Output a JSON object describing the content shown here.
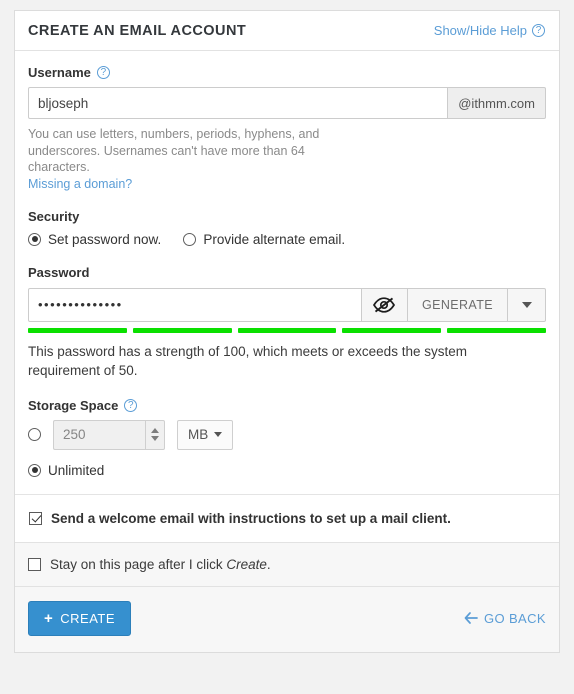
{
  "header": {
    "title": "CREATE AN EMAIL ACCOUNT",
    "help_toggle": "Show/Hide Help",
    "help_icon": "question-circle-icon"
  },
  "username": {
    "label": "Username",
    "help_icon": "question-circle-icon",
    "value": "bljoseph",
    "placeholder": "",
    "domain_addon": "@ithmm.com",
    "help_text": "You can use letters, numbers, periods, hyphens, and underscores. Usernames can't have more than 64 characters.",
    "missing_domain_link": "Missing a domain?"
  },
  "security": {
    "section_label": "Security",
    "options": [
      {
        "label": "Set password now.",
        "selected": true
      },
      {
        "label": "Provide alternate email.",
        "selected": false
      }
    ]
  },
  "password": {
    "label": "Password",
    "value": "••••••••••••••",
    "toggle_icon": "eye-slash-icon",
    "generate_label": "GENERATE",
    "caret_icon": "chevron-down-icon",
    "strength_segments": 5,
    "strength_color": "#0ae000",
    "strength_text": "This password has a strength of 100, which meets or exceeds the system requirement of 50.",
    "strength_value": 100,
    "strength_requirement": 50
  },
  "storage": {
    "label": "Storage Space",
    "help_icon": "question-circle-icon",
    "quota_selected": false,
    "quota_value": "250",
    "unit": "MB",
    "unit_caret_icon": "chevron-down-icon",
    "spinner_up_icon": "spinner-up-icon",
    "spinner_down_icon": "spinner-down-icon",
    "unlimited_label": "Unlimited",
    "unlimited_selected": true
  },
  "welcome": {
    "label": "Send a welcome email with instructions to set up a mail client.",
    "checked": true
  },
  "stay": {
    "label_prefix": "Stay on this page after I click ",
    "label_emphasis": "Create",
    "label_suffix": ".",
    "checked": false
  },
  "actions": {
    "create_label": "CREATE",
    "create_icon": "plus-icon",
    "create_color": "#3690cf",
    "go_back_label": "GO BACK",
    "go_back_icon": "arrow-left-icon",
    "link_color": "#5b9dd6"
  }
}
